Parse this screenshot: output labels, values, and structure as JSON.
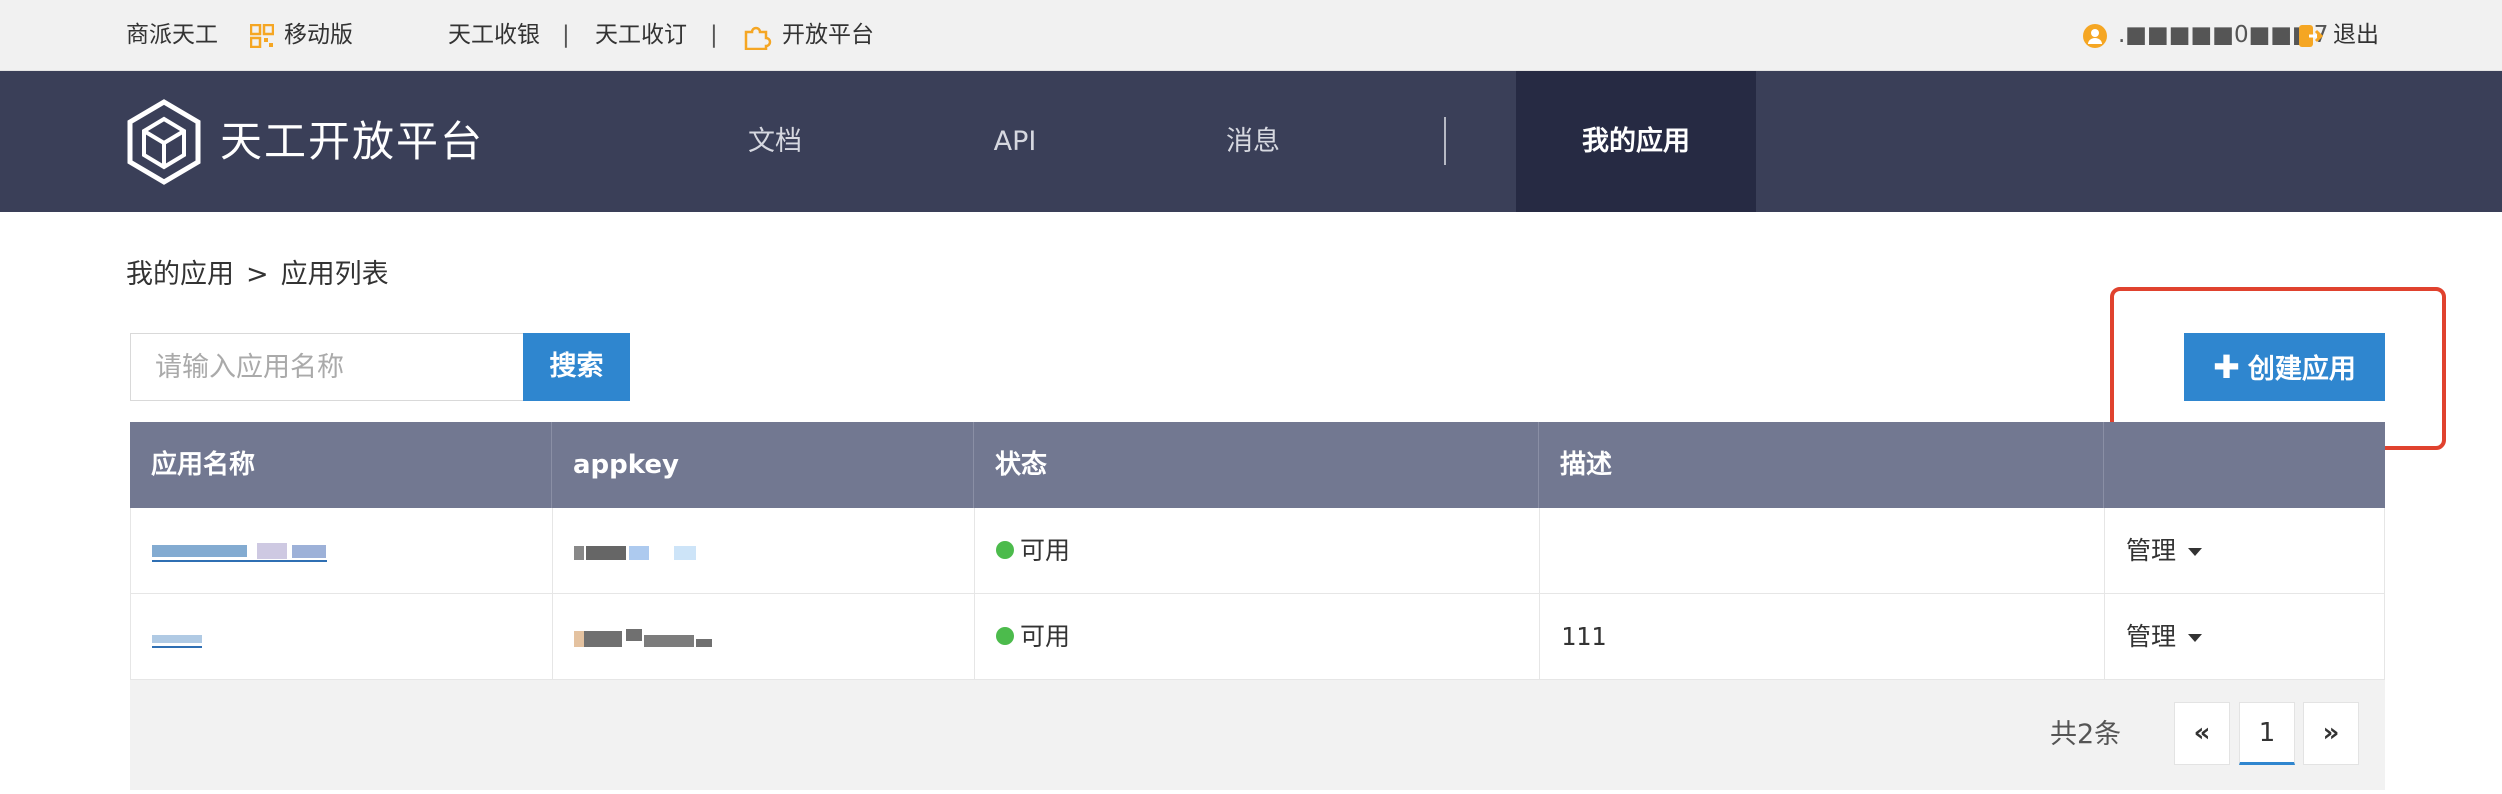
{
  "topbar": {
    "brand_link": "商派天工",
    "mobile_link": "移动版",
    "cashier_link": "天工收银",
    "divider": "|",
    "order_link": "天工收订",
    "open_platform_link": "开放平台",
    "user_account": ".■■■■■0■■■7",
    "logout_link": "退出"
  },
  "navbar": {
    "brand": "天工开放平台",
    "items": [
      "文档",
      "API",
      "消息"
    ],
    "active_item": "我的应用"
  },
  "breadcrumb": {
    "root": "我的应用",
    "separator": ">",
    "current": "应用列表"
  },
  "search": {
    "placeholder": "请输入应用名称",
    "button_label": "搜索"
  },
  "create_button": {
    "icon": "plus-icon",
    "label": "创建应用"
  },
  "table": {
    "columns": [
      "应用名称",
      "appkey",
      "状态",
      "描述",
      ""
    ],
    "rows": [
      {
        "name": "",
        "appkey": "",
        "status": "可用",
        "description": "",
        "action": "管理"
      },
      {
        "name": "",
        "appkey": "",
        "status": "可用",
        "description": "111",
        "action": "管理"
      }
    ]
  },
  "pagination": {
    "total": "共2条",
    "prev": "«",
    "current_page": "1",
    "next": "»"
  },
  "colors": {
    "topbar_bg": "#f1f1f1",
    "navbar_bg": "#3a3f58",
    "nav_active_bg": "#262a43",
    "primary": "#2f86cf",
    "table_header_bg": "#727891",
    "status_ok": "#4cbb4c",
    "highlight": "#e0422e",
    "icon_orange": "#f5a623"
  }
}
